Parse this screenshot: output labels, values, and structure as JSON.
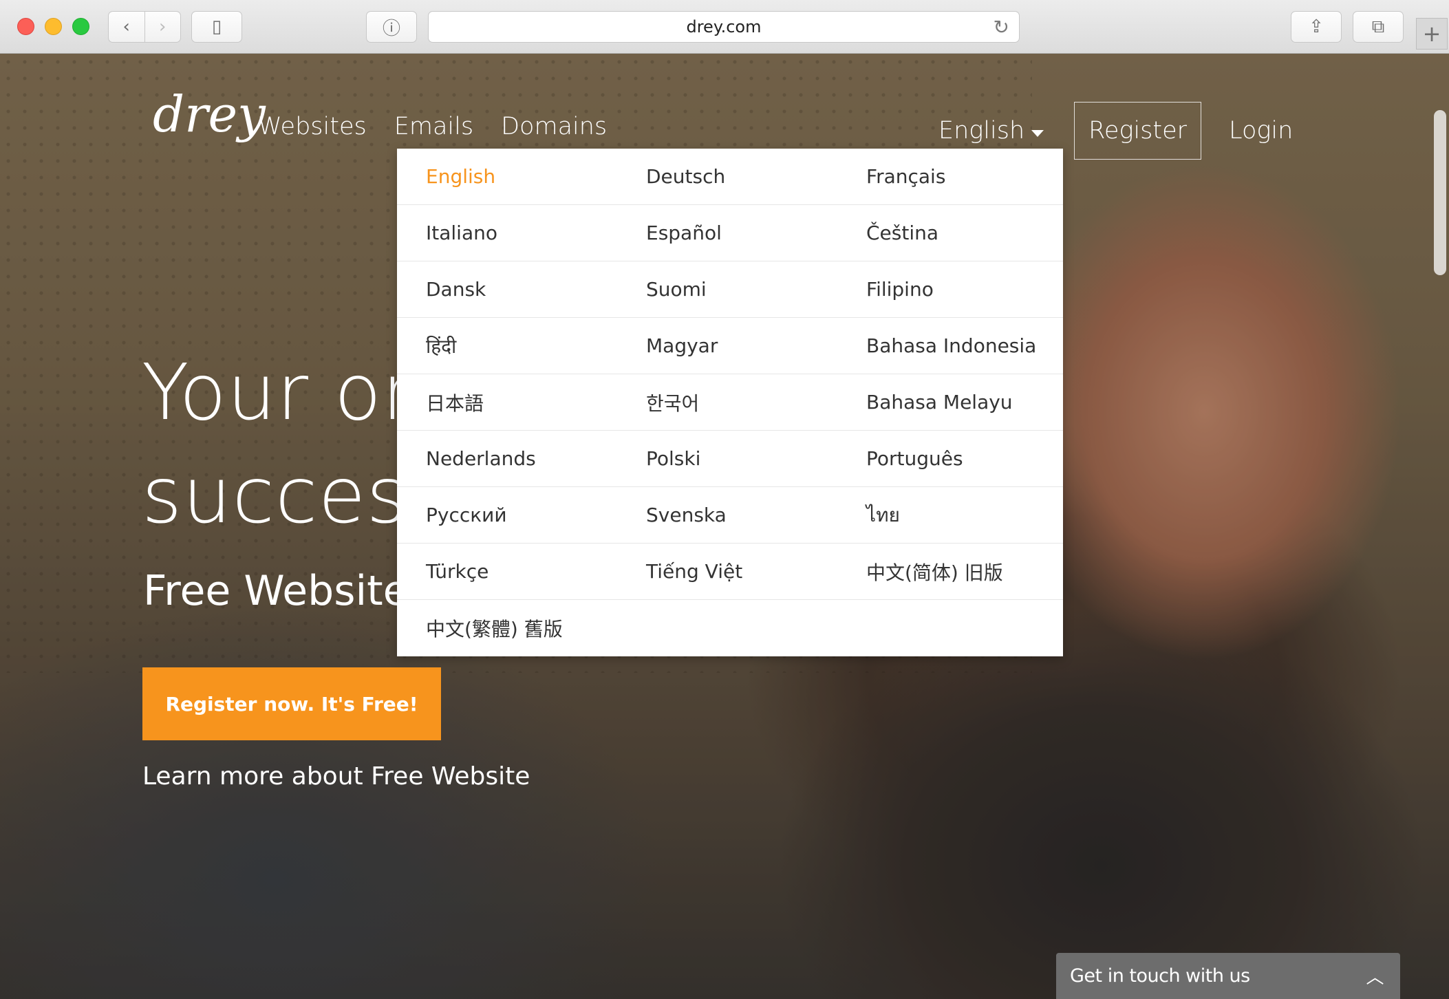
{
  "browser": {
    "url": "drey.com",
    "back_icon": "‹",
    "forward_icon": "›",
    "sidebar_icon": "▯",
    "privacy_icon": "ⓘ",
    "reload_icon": "↻",
    "share_icon": "⇪",
    "tabs_icon": "⧉",
    "newtab_icon": "+"
  },
  "site": {
    "logo": "drey",
    "nav": [
      "Websites",
      "Emails",
      "Domains"
    ],
    "language_label": "English",
    "register_label": "Register",
    "login_label": "Login"
  },
  "hero": {
    "headline_line1": "Your on",
    "headline_line2": "success",
    "subheading": "Free Website",
    "cta_label": "Register now. It's Free!",
    "learn_more": "Learn more about Free Website"
  },
  "language_menu": {
    "selected": "English",
    "rows": [
      [
        "English",
        "Deutsch",
        "Français"
      ],
      [
        "Italiano",
        "Español",
        "Čeština"
      ],
      [
        "Dansk",
        "Suomi",
        "Filipino"
      ],
      [
        "हिंदी",
        "Magyar",
        "Bahasa Indonesia"
      ],
      [
        "日本語",
        "한국어",
        "Bahasa Melayu"
      ],
      [
        "Nederlands",
        "Polski",
        "Português"
      ],
      [
        "Русский",
        "Svenska",
        "ไทย"
      ],
      [
        "Türkçe",
        "Tiếng Việt",
        "中文(简体) 旧版"
      ],
      [
        "中文(繁體) 舊版",
        "",
        ""
      ]
    ]
  },
  "chat": {
    "label": "Get in touch with us",
    "toggle_icon": "︿"
  },
  "colors": {
    "accent": "#f7941d",
    "chat_bg": "#6d6d6d"
  }
}
